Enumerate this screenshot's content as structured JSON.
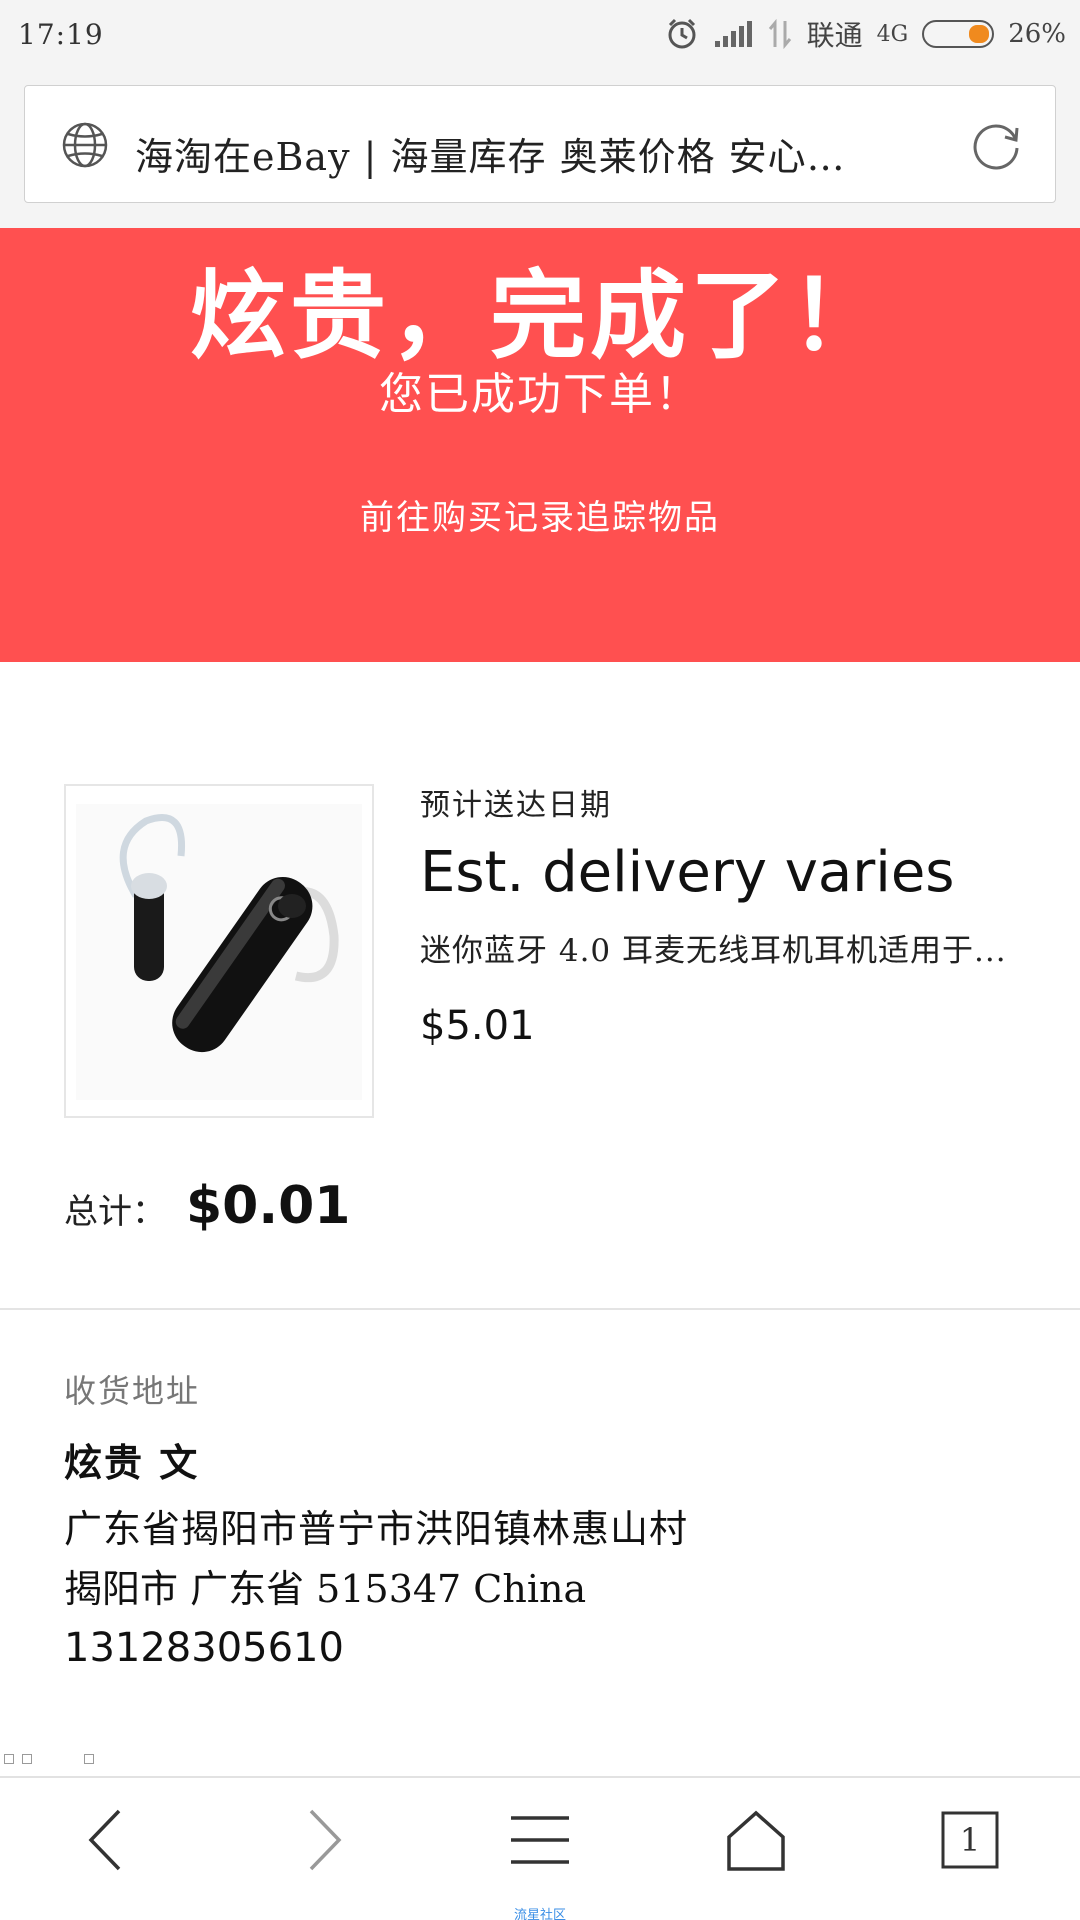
{
  "status_bar": {
    "time": "17:19",
    "carrier": "联通",
    "network": "4G",
    "battery": "26%"
  },
  "browser": {
    "url_title": "海淘在eBay | 海量库存 奥莱价格 安心…"
  },
  "hero": {
    "title": "炫贵，完成了！",
    "subtitle": "您已成功下单！",
    "link": "前往购买记录追踪物品",
    "background_color": "#ff5050"
  },
  "item": {
    "image_icon": "bluetooth-headset-icon",
    "delivery_label": "预计送达日期",
    "delivery_value": "Est. delivery varies",
    "title": "迷你蓝牙 4.0 耳麦无线耳机耳机适用于...",
    "price": "$5.01"
  },
  "total": {
    "label": "总计：",
    "value": "$0.01"
  },
  "address": {
    "section_title": "收货地址",
    "name": "炫贵 文",
    "line1": "广东省揭阳市普宁市洪阳镇林惠山村",
    "line2": "揭阳市 广东省 515347 China",
    "phone": "13128305610"
  },
  "bottom_nav": {
    "tab_count": "1",
    "caption": "流星社区"
  }
}
